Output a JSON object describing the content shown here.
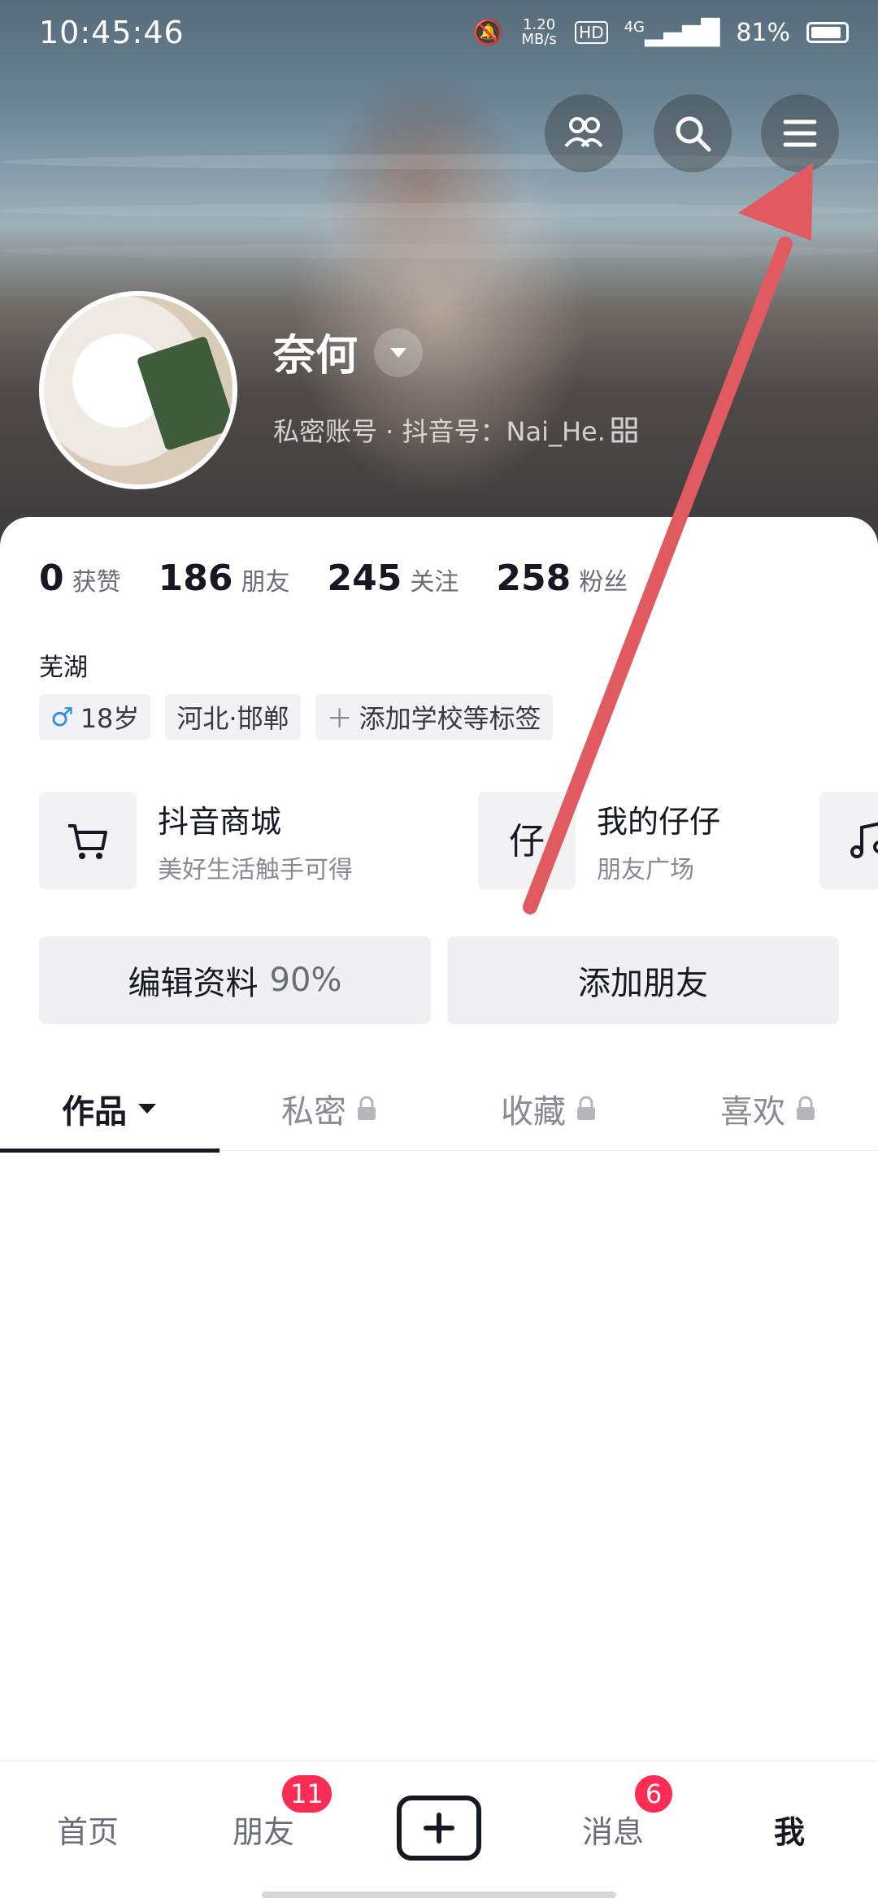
{
  "status_bar": {
    "time": "10:45:46",
    "network_speed": "1.20 MB/s",
    "hd_label": "HD",
    "network_type": "4G",
    "battery": "81%"
  },
  "header_buttons": [
    "friends-icon",
    "search-icon",
    "menu-icon"
  ],
  "profile": {
    "name": "奈何",
    "sub_info": "私密账号 · 抖音号：Nai_He."
  },
  "stats": [
    {
      "num": "0",
      "label": "获赞"
    },
    {
      "num": "186",
      "label": "朋友"
    },
    {
      "num": "245",
      "label": "关注"
    },
    {
      "num": "258",
      "label": "粉丝"
    }
  ],
  "location": "芜湖",
  "tags": {
    "gender_symbol": "♂",
    "age": "18岁",
    "region": "河北·邯郸",
    "add_tag": "添加学校等标签"
  },
  "cards": [
    {
      "title": "抖音商城",
      "sub": "美好生活触手可得",
      "icon": "cart-icon"
    },
    {
      "title": "我的仔仔",
      "sub": "朋友广场",
      "icon": "zaizai-icon"
    },
    {
      "title": "",
      "sub": "",
      "icon": "music-icon"
    }
  ],
  "buttons": {
    "edit_label": "编辑资料",
    "edit_percent": "90%",
    "add_friend": "添加朋友"
  },
  "tabs": [
    {
      "label": "作品",
      "active": true
    },
    {
      "label": "私密",
      "locked": true
    },
    {
      "label": "收藏",
      "locked": true
    },
    {
      "label": "喜欢",
      "locked": true
    }
  ],
  "bottom_nav": {
    "home": "首页",
    "friends": "朋友",
    "friends_badge": "11",
    "messages": "消息",
    "messages_badge": "6",
    "me": "我"
  },
  "colors": {
    "badge": "#fe2c55",
    "annotation_arrow": "#e05a5f"
  }
}
